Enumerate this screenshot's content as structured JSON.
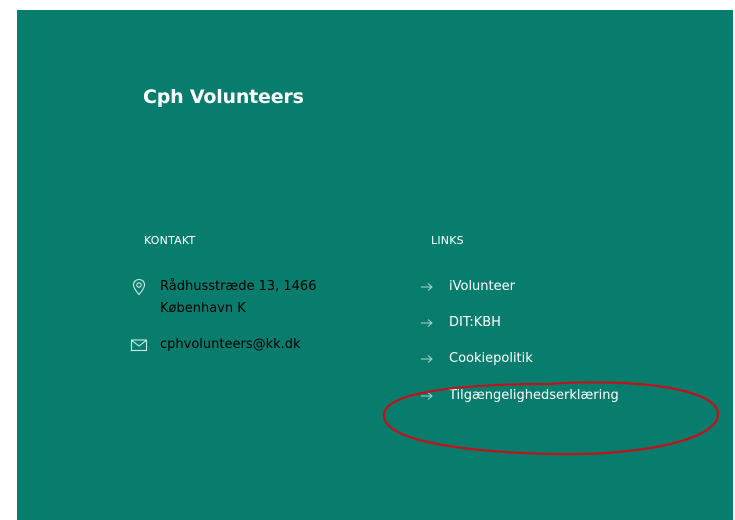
{
  "brand": {
    "name": "Cph Volunteers"
  },
  "kontakt": {
    "title": "KONTAKT",
    "address_line1": "Rådhusstræde 13, 1466",
    "address_line2": "København K",
    "email": "cphvolunteers@kk.dk"
  },
  "links": {
    "title": "LINKS",
    "items": [
      {
        "label": "iVolunteer"
      },
      {
        "label": "DIT:KBH"
      },
      {
        "label": "Cookiepolitik"
      },
      {
        "label": "Tilgængelighedserklæring"
      }
    ]
  },
  "colors": {
    "background": "#087d6d",
    "text": "#ffffff",
    "annotation": "#c0121a"
  },
  "icons": {
    "address": "location-pin-icon",
    "email": "envelope-icon",
    "link": "arrow-right-icon"
  },
  "annotation": {
    "type": "ellipse",
    "target": "Tilgængelighedserklæring"
  }
}
